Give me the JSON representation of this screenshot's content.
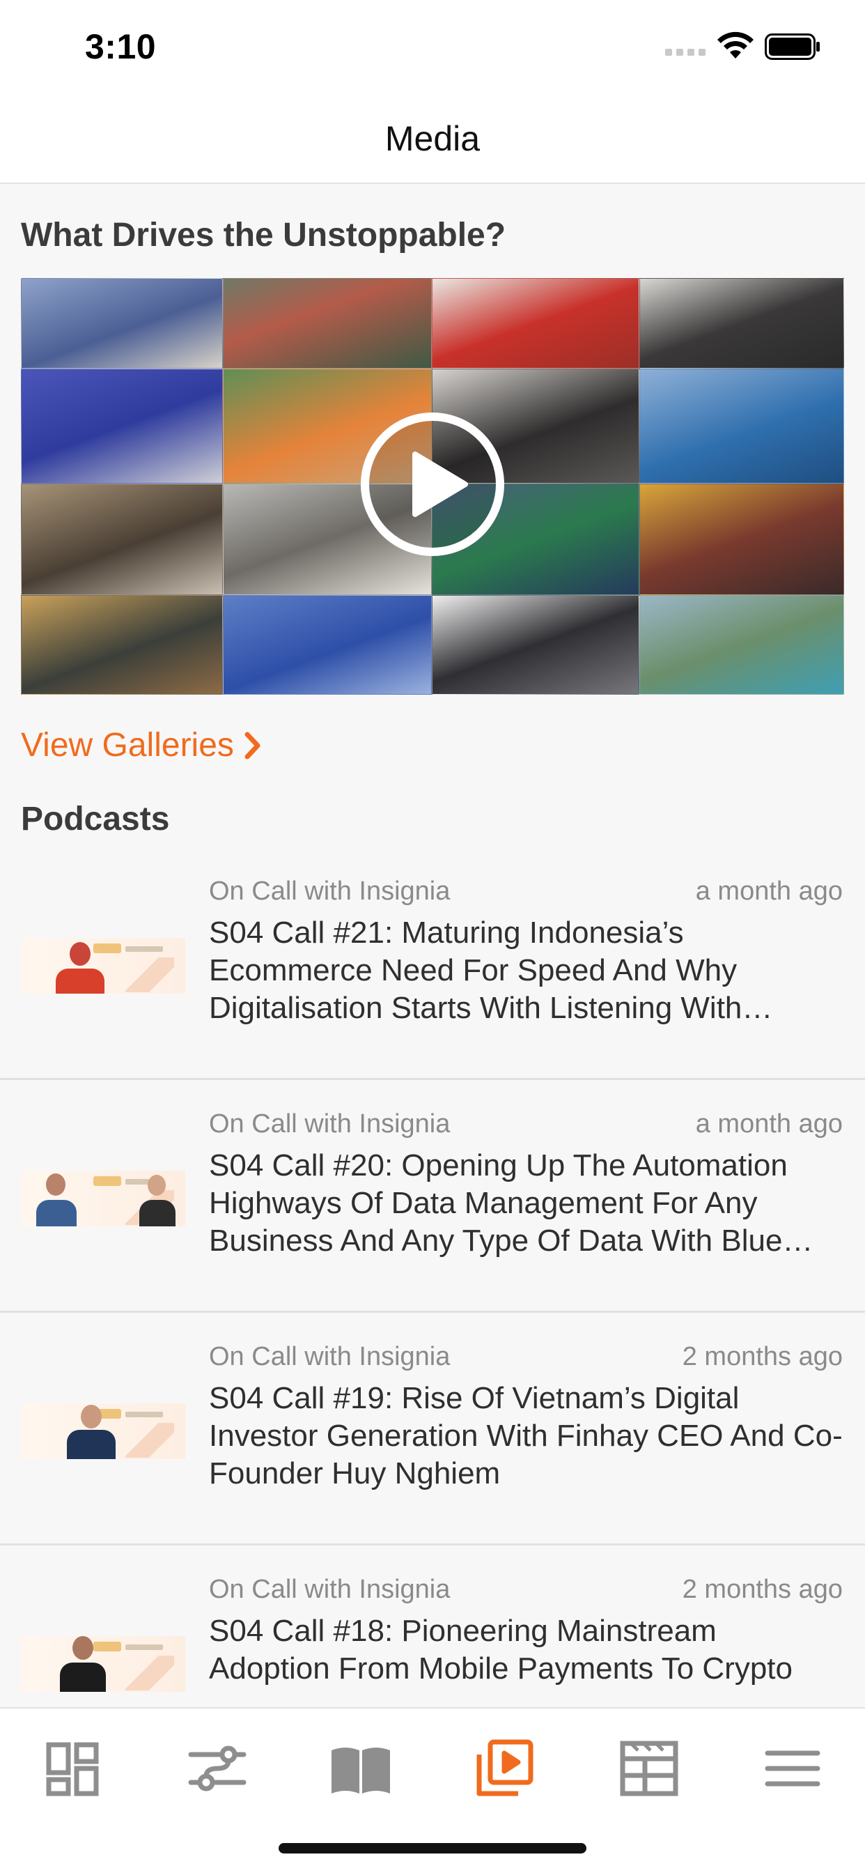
{
  "status_bar": {
    "time": "3:10"
  },
  "header": {
    "title": "Media"
  },
  "featured": {
    "title": "What Drives the Unstoppable?",
    "play_icon": "play-circle-icon",
    "view_galleries_label": "View Galleries",
    "accent_color": "#f06b1e"
  },
  "podcasts": {
    "heading": "Podcasts",
    "items": [
      {
        "show": "On Call with Insignia",
        "age": "a month ago",
        "title": "S04 Call #21: Maturing Indonesia’s Ecommerce Need For Speed And Why Digitalisation Starts With Listening With Shopee CEO"
      },
      {
        "show": "On Call with Insignia",
        "age": "a month ago",
        "title": "S04 Call #20: Opening Up The Automation Highways Of Data Management For Any Business And Any Type Of Data With Blue Prism"
      },
      {
        "show": "On Call with Insignia",
        "age": "2 months ago",
        "title": "S04 Call #19: Rise Of Vietnam’s Digital Investor Generation With Finhay CEO And Co-Founder Huy Nghiem"
      },
      {
        "show": "On Call with Insignia",
        "age": "2 months ago",
        "title": "S04 Call #18: Pioneering Mainstream Adoption From Mobile Payments To Crypto"
      }
    ]
  },
  "tab_bar": {
    "items": [
      {
        "name": "dashboard-icon",
        "active": false
      },
      {
        "name": "sliders-icon",
        "active": false
      },
      {
        "name": "book-icon",
        "active": false
      },
      {
        "name": "media-play-icon",
        "active": true
      },
      {
        "name": "calendar-board-icon",
        "active": false
      },
      {
        "name": "menu-icon",
        "active": false
      }
    ],
    "active_color": "#f06b1e",
    "inactive_color": "#8e8e8e"
  }
}
